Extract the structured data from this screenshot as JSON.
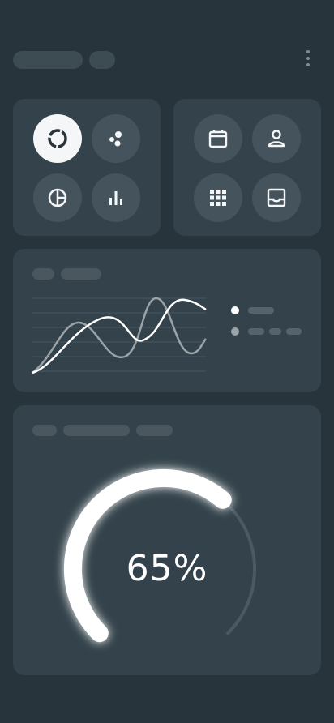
{
  "header": {
    "menu_icon": "more-vertical-icon"
  },
  "chart_types": {
    "items": [
      {
        "icon": "donut-chart-icon",
        "active": true
      },
      {
        "icon": "scatter-chart-icon",
        "active": false
      },
      {
        "icon": "pie-chart-icon",
        "active": false
      },
      {
        "icon": "bar-chart-icon",
        "active": false
      }
    ]
  },
  "quick_actions": {
    "items": [
      {
        "icon": "calendar-icon"
      },
      {
        "icon": "user-icon"
      },
      {
        "icon": "grid-icon"
      },
      {
        "icon": "inbox-icon"
      }
    ]
  },
  "colors": {
    "background": "#27343b",
    "card": "#34434b",
    "accent": "#ffffff",
    "muted": "#9aa3a8"
  },
  "gauge": {
    "value_label": "65%",
    "progress": 0.65
  }
}
